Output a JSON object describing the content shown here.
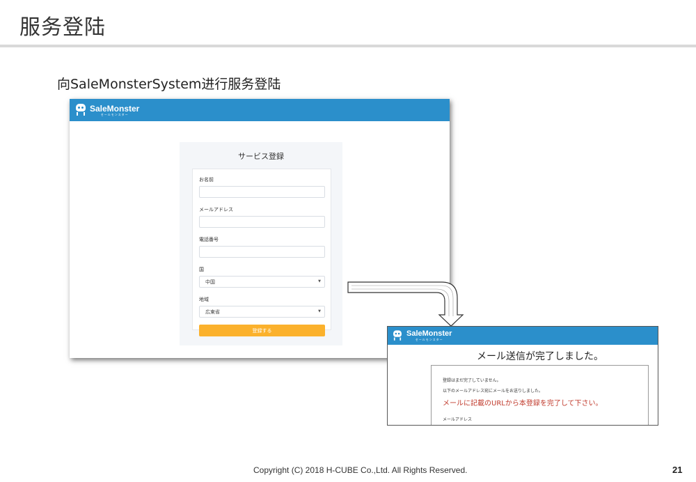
{
  "slide": {
    "title": "服务登陆",
    "subtitle": "向SaleMonsterSystem进行服务登陆",
    "copyright": "Copyright (C) 2018 H-CUBE Co.,Ltd. All Rights Reserved.",
    "page_number": "21"
  },
  "brand": {
    "name": "SaleMonster",
    "kana": "セールモンスター",
    "header_color": "#2b8fcb"
  },
  "registration_form": {
    "title": "サービス登録",
    "fields": {
      "name_label": "お名前",
      "name_value": "",
      "email_label": "メールアドレス",
      "email_value": "",
      "phone_label": "電話番号",
      "phone_value": "",
      "country_label": "国",
      "country_value": "中国",
      "region_label": "地域",
      "region_value": "広東省"
    },
    "submit_label": "登録する",
    "submit_color": "#fbb12c"
  },
  "confirmation": {
    "title": "メール送信が完了しました。",
    "line1": "登録はまだ完了していません。",
    "line2": "以下のメールアドレス宛にメールをお送りしました。",
    "highlight": "メールに記載のURLから本登録を完了して下さい。",
    "line3": "メールアドレス"
  }
}
